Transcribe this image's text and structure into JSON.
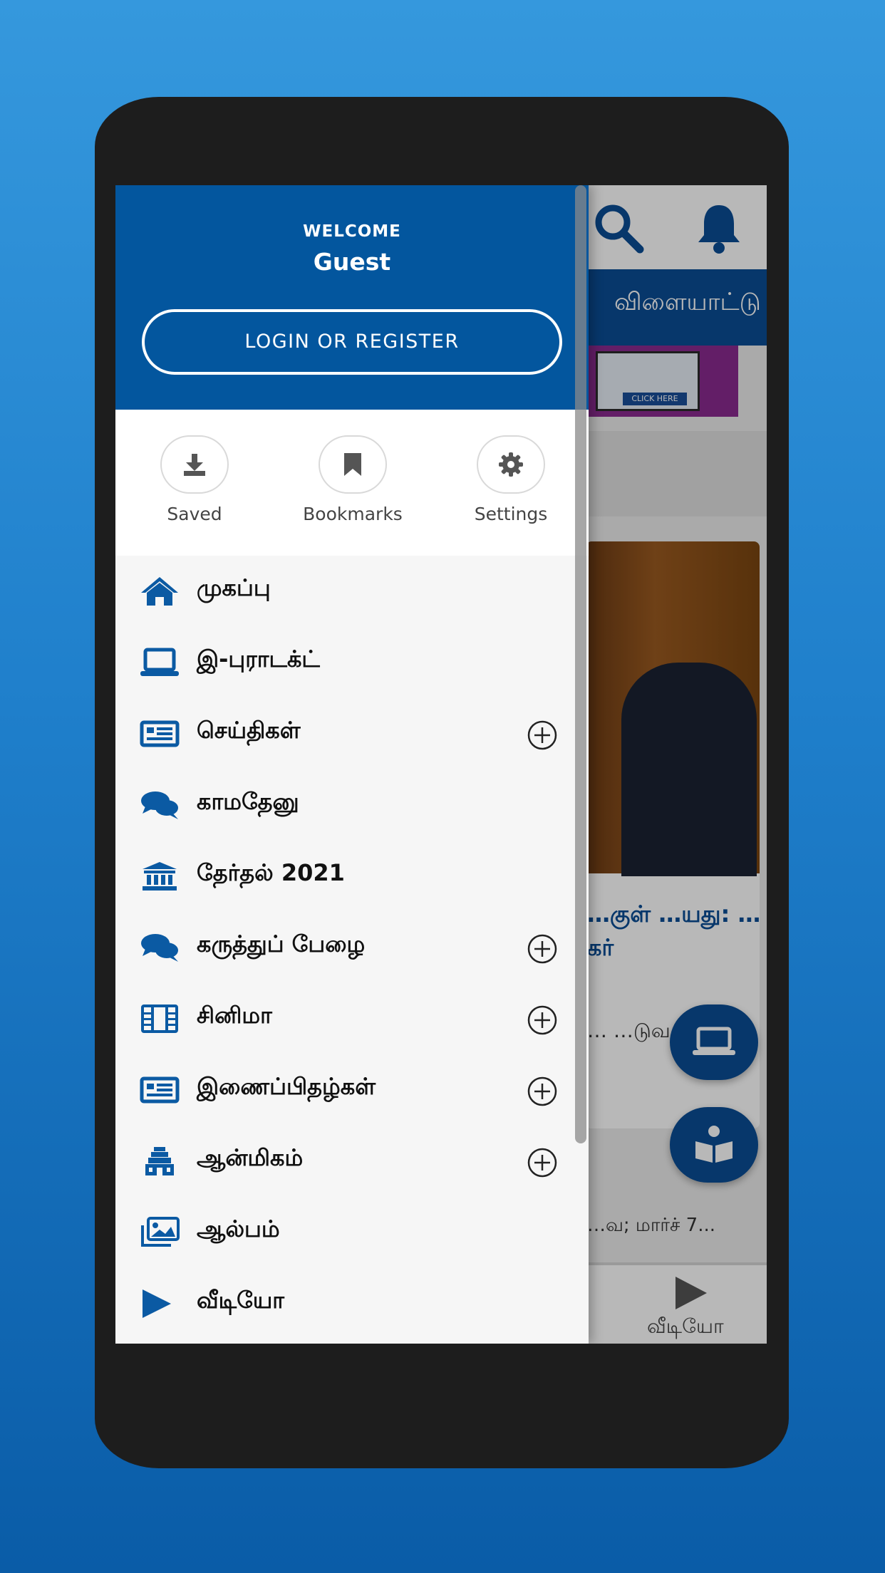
{
  "colors": {
    "accent": "#03569e",
    "icon_blue": "#0b5aa3",
    "bg_gradient_top": "#3598dd",
    "bg_gradient_bottom": "#0a5ca7"
  },
  "app": {
    "tab_label": "விளையாட்டு",
    "headline": "…குள் …யது: …கர்",
    "snippet": "… …டுவருவ…",
    "date_text": "…வ; மார்ச் 7...",
    "bottom_nav_video_label": "வீடியோ",
    "banner_button": "CLICK HERE"
  },
  "drawer": {
    "welcome": "WELCOME",
    "user_name": "Guest",
    "login_button": "LOGIN OR REGISTER",
    "quick_actions": [
      {
        "label": "Saved",
        "icon": "download-icon"
      },
      {
        "label": "Bookmarks",
        "icon": "bookmark-icon"
      },
      {
        "label": "Settings",
        "icon": "gear-icon"
      }
    ],
    "menu": [
      {
        "label": "முகப்பு",
        "icon": "home-icon",
        "expandable": false
      },
      {
        "label": "இ-புராடக்ட்",
        "icon": "laptop-icon",
        "expandable": false
      },
      {
        "label": "செய்திகள்",
        "icon": "newspaper-icon",
        "expandable": true
      },
      {
        "label": "காமதேனு",
        "icon": "chat-icon",
        "expandable": false
      },
      {
        "label": "தேர்தல் 2021",
        "icon": "government-building-icon",
        "expandable": false
      },
      {
        "label": "கருத்துப் பேழை",
        "icon": "chat-icon",
        "expandable": true
      },
      {
        "label": "சினிமா",
        "icon": "film-icon",
        "expandable": true
      },
      {
        "label": "இணைப்பிதழ்கள்",
        "icon": "newspaper-icon",
        "expandable": true
      },
      {
        "label": "ஆன்மிகம்",
        "icon": "temple-icon",
        "expandable": true
      },
      {
        "label": "ஆல்பம்",
        "icon": "images-icon",
        "expandable": false
      },
      {
        "label": "வீடியோ",
        "icon": "play-icon",
        "expandable": false
      }
    ]
  }
}
